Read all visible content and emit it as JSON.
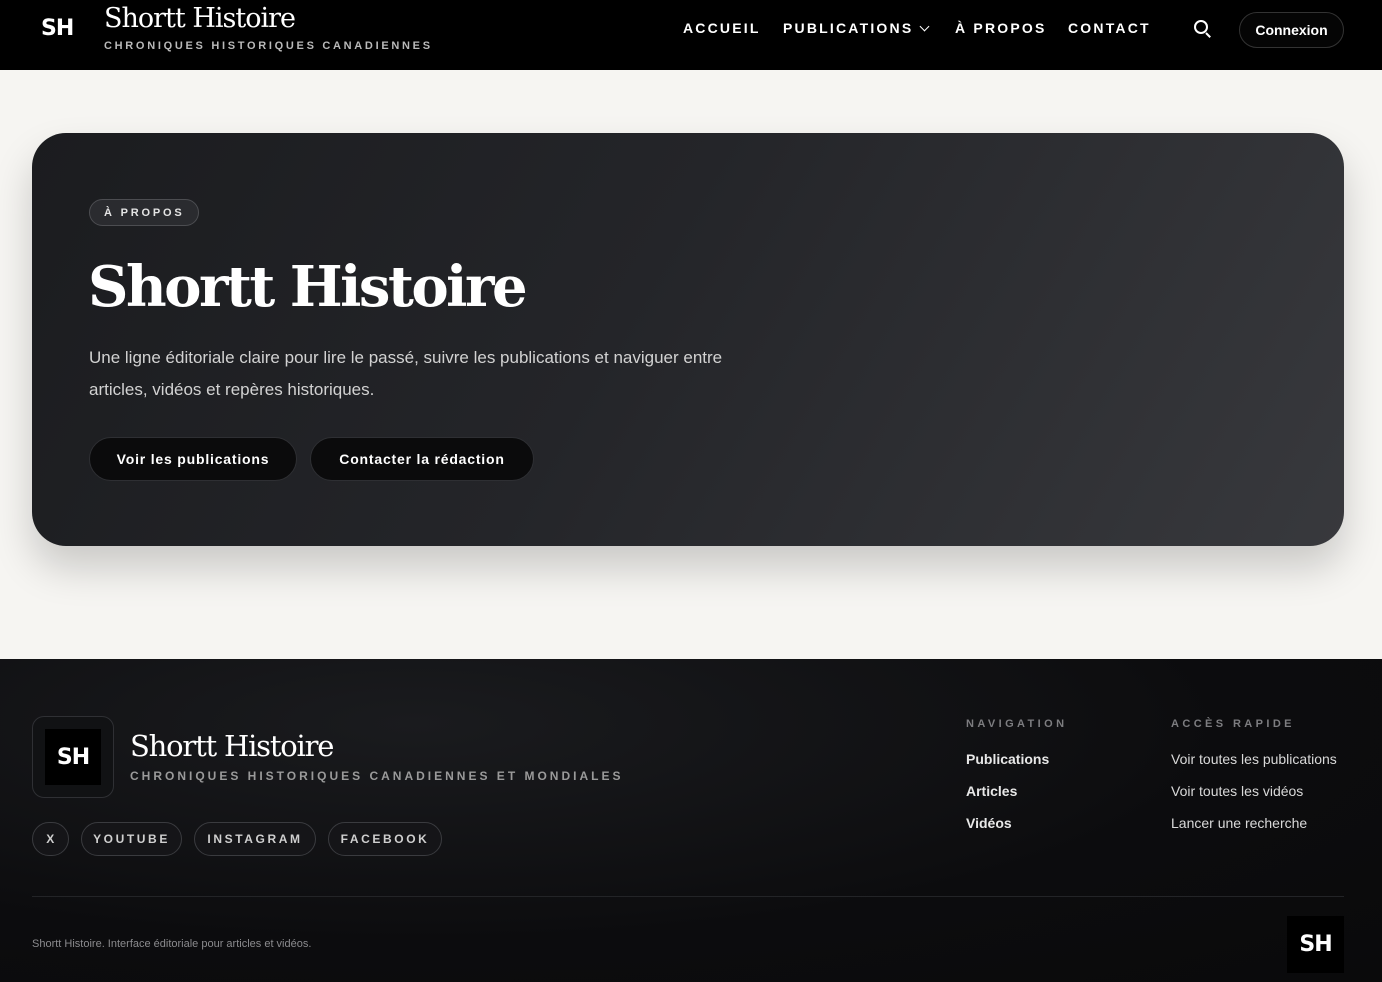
{
  "header": {
    "logo": "SH",
    "title": "Shortt Histoire",
    "subtitle": "CHRONIQUES HISTORIQUES CANADIENNES",
    "nav": [
      "ACCUEIL",
      "PUBLICATIONS",
      "À PROPOS",
      "CONTACT"
    ],
    "search_icon": "search-icon",
    "login_label": "Connexion"
  },
  "hero": {
    "badge": "À PROPOS",
    "title": "Shortt Histoire",
    "description": "Une ligne éditoriale claire pour lire le passé, suivre les publications et naviguer entre articles, vidéos et repères historiques.",
    "primary_button": "Voir les publications",
    "secondary_button": "Contacter la rédaction"
  },
  "footer": {
    "logo": "SH",
    "title": "Shortt Histoire",
    "subtitle": "CHRONIQUES HISTORIQUES CANADIENNES ET MONDIALES",
    "social": [
      "X",
      "YOUTUBE",
      "INSTAGRAM",
      "FACEBOOK"
    ],
    "navigation": {
      "heading": "NAVIGATION",
      "links": [
        "Publications",
        "Articles",
        "Vidéos"
      ]
    },
    "quick_access": {
      "heading": "ACCÈS RAPIDE",
      "links": [
        "Voir toutes les publications",
        "Voir toutes les vidéos",
        "Lancer une recherche"
      ]
    },
    "copyright": "Shortt Histoire. Interface éditoriale pour articles et vidéos.",
    "badge": "SH"
  },
  "colors": {
    "header_bg": "#000000",
    "page_bg": "#f6f5f2",
    "hero_bg": "#242529",
    "footer_bg": "#0c0c0e"
  }
}
